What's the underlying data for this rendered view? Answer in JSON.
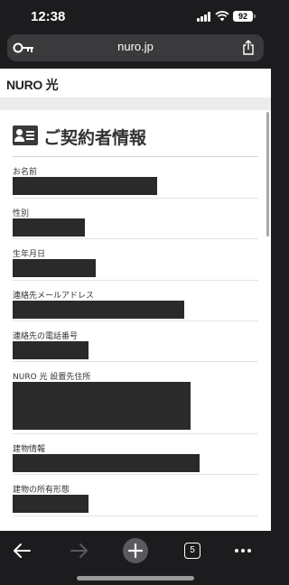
{
  "status_bar": {
    "time": "12:38",
    "battery": "92"
  },
  "browser": {
    "url": "nuro.jp",
    "tabs_count": "5"
  },
  "site": {
    "logo": "NURO 光"
  },
  "section": {
    "title": "ご契約者情報"
  },
  "fields": [
    {
      "label": "お名前"
    },
    {
      "label": "性別"
    },
    {
      "label": "生年月日"
    },
    {
      "label": "連絡先メールアドレス"
    },
    {
      "label": "連絡先の電話番号"
    },
    {
      "label": "NURO 光 設置先住所"
    },
    {
      "label": "建物情報"
    },
    {
      "label": "建物の所有形態"
    }
  ],
  "icons": [
    "key-icon",
    "share-icon",
    "contact-card-icon",
    "back-arrow-icon",
    "forward-arrow-icon",
    "plus-icon",
    "more-icon"
  ]
}
